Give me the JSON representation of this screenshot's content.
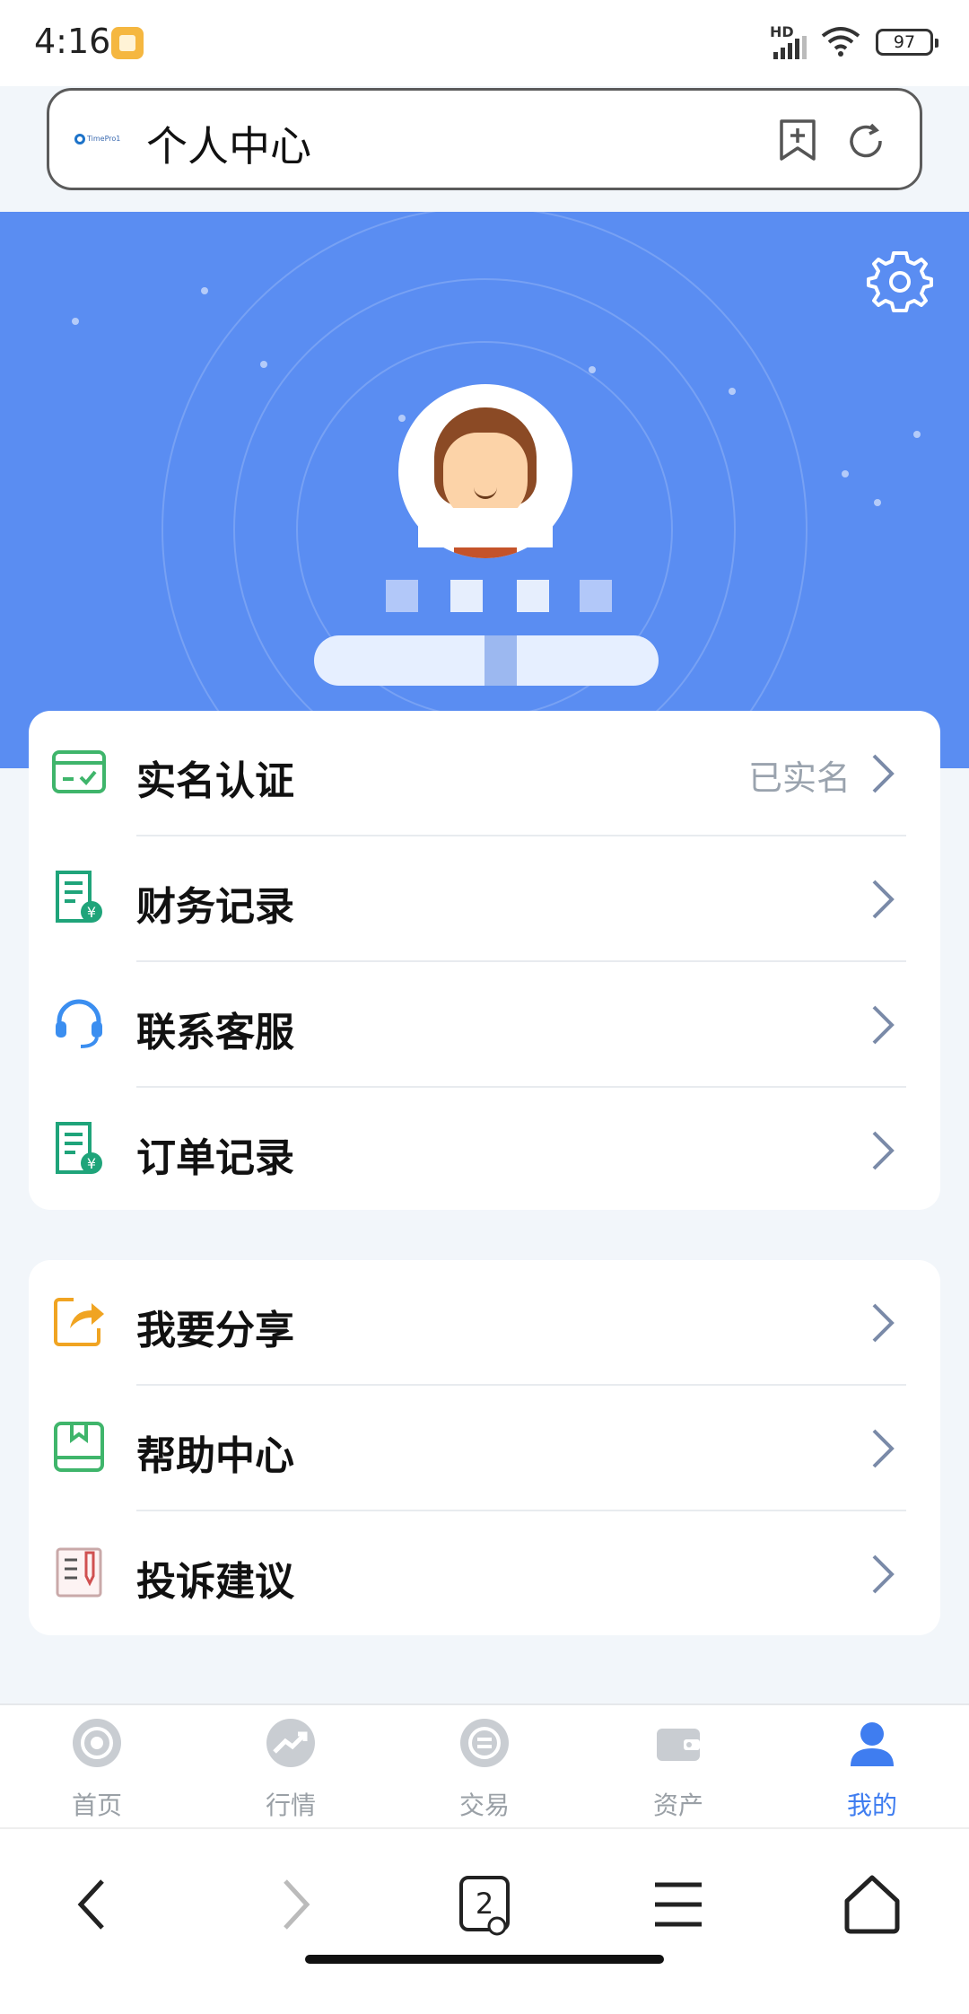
{
  "status_bar": {
    "time": "4:16",
    "network": "HD",
    "battery": "97"
  },
  "address_bar": {
    "title": "个人中心",
    "logo_text": "TimePro1"
  },
  "menu_group_1": [
    {
      "label": "实名认证",
      "value": "已实名",
      "icon": "id-card-check-icon",
      "color": "#3fb56b"
    },
    {
      "label": "财务记录",
      "value": "",
      "icon": "finance-record-icon",
      "color": "#1fa47a"
    },
    {
      "label": "联系客服",
      "value": "",
      "icon": "headset-icon",
      "color": "#3b8ef0"
    },
    {
      "label": "订单记录",
      "value": "",
      "icon": "order-record-icon",
      "color": "#1fa47a"
    }
  ],
  "menu_group_2": [
    {
      "label": "我要分享",
      "value": "",
      "icon": "share-icon",
      "color": "#f0a422"
    },
    {
      "label": "帮助中心",
      "value": "",
      "icon": "help-book-icon",
      "color": "#3fb56b"
    },
    {
      "label": "投诉建议",
      "value": "",
      "icon": "complaint-icon",
      "color": "#d05050"
    }
  ],
  "tabs": [
    {
      "label": "首页",
      "icon": "home-tab-icon",
      "active": false
    },
    {
      "label": "行情",
      "icon": "market-tab-icon",
      "active": false
    },
    {
      "label": "交易",
      "icon": "trade-tab-icon",
      "active": false
    },
    {
      "label": "资产",
      "icon": "wallet-tab-icon",
      "active": false
    },
    {
      "label": "我的",
      "icon": "profile-tab-icon",
      "active": true
    }
  ],
  "browser_nav": {
    "tab_count": "2"
  },
  "colors": {
    "header_blue": "#5a8df2",
    "active_tab": "#3f7df0",
    "chevron": "#7a8aa8"
  }
}
